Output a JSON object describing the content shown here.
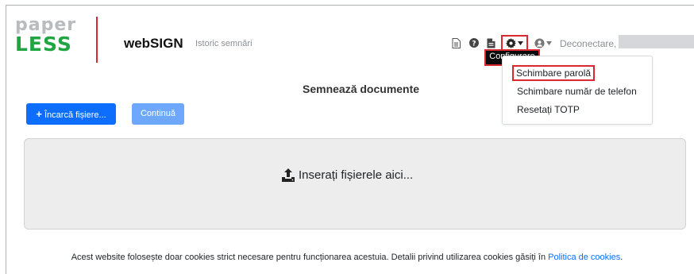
{
  "header": {
    "logo_top": "paper",
    "logo_bottom": "LESS",
    "brand": "webSIGN",
    "nav_history": "Istoric semnări",
    "logout": "Deconectare,"
  },
  "toolbar": {
    "tooltip": "Configurare"
  },
  "settings_menu": {
    "items": [
      {
        "label": "Schimbare parolă"
      },
      {
        "label": "Schimbare număr de telefon"
      },
      {
        "label": "Resetați TOTP"
      }
    ]
  },
  "main": {
    "title": "Semnează documente",
    "upload_button": "Încarcă fișiere...",
    "continue_button": "Continuă",
    "dropzone_label": "Inserați fișierele aici..."
  },
  "footer": {
    "cookie_text": "Acest website folosește doar cookies strict necesare pentru funcționarea acestuia. Detalii privind utilizarea cookies găsiți în ",
    "cookie_link": "Politica de cookies",
    "cookie_end": "."
  },
  "colors": {
    "accent": "#0d6efd",
    "logo_green": "#1fa541",
    "highlight_red": "#d9282f"
  }
}
